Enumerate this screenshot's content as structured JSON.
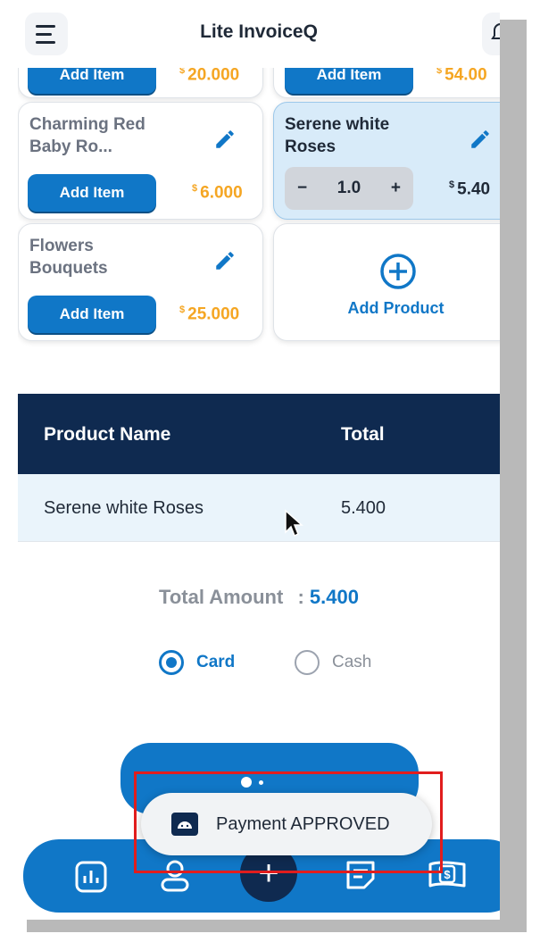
{
  "app": {
    "title": "Lite InvoiceQ"
  },
  "products": [
    {
      "name": "",
      "add_label": "Add Item",
      "currency": "$",
      "price": "20.000"
    },
    {
      "name": "",
      "add_label": "Add Item",
      "currency": "$",
      "price": "54.00"
    },
    {
      "name": "Charming Red Baby Ro...",
      "add_label": "Add Item",
      "currency": "$",
      "price": "6.000"
    },
    {
      "name": "Serene white Roses",
      "selected": true,
      "quantity": "1.0",
      "currency": "$",
      "price": "5.40"
    },
    {
      "name": "Flowers Bouquets",
      "add_label": "Add Item",
      "currency": "$",
      "price": "25.000"
    }
  ],
  "add_product": {
    "label": "Add Product"
  },
  "table": {
    "headers": [
      "Product Name",
      "Total"
    ],
    "rows": [
      {
        "name": "Serene white Roses",
        "total": "5.400"
      }
    ]
  },
  "total": {
    "label": "Total Amount",
    "separator": ":",
    "value": "5.400"
  },
  "payment_methods": [
    {
      "label": "Card",
      "selected": true
    },
    {
      "label": "Cash",
      "selected": false
    }
  ],
  "toast": {
    "message": "Payment APPROVED"
  },
  "stepper": {
    "minus": "−",
    "plus": "+"
  },
  "fab": {
    "symbol": "+"
  },
  "colors": {
    "primary": "#1077c7",
    "dark_navy": "#0f2a50",
    "price_orange": "#f5a623",
    "highlight_red": "#e11d1d"
  }
}
